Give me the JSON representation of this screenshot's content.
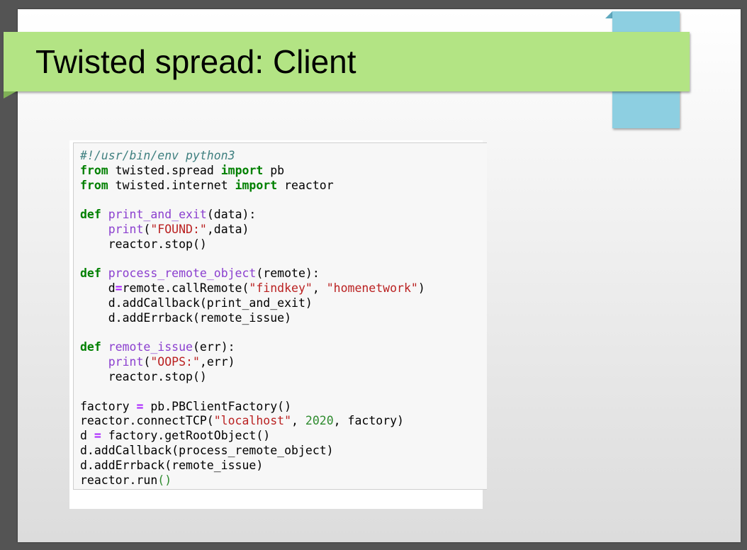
{
  "slide": {
    "title": "Twisted spread: Client"
  },
  "colors": {
    "background": "#545454",
    "title_bar": "#b3e484",
    "accent_tab": "#8dcfe1",
    "code_background": "#f7f7f7",
    "comment": "#408080",
    "keyword": "#008000",
    "builtin": "#8b3fcf",
    "string": "#ba2121",
    "number": "#2e8b2e"
  },
  "code": {
    "language": "python",
    "lines": [
      [
        {
          "t": "#!/usr/bin/env python3",
          "k": "comment"
        }
      ],
      [
        {
          "t": "from",
          "k": "keyword"
        },
        {
          "t": " twisted.spread ",
          "k": "plain"
        },
        {
          "t": "import",
          "k": "keyword"
        },
        {
          "t": " pb",
          "k": "plain"
        }
      ],
      [
        {
          "t": "from",
          "k": "keyword"
        },
        {
          "t": " twisted.internet ",
          "k": "plain"
        },
        {
          "t": "import",
          "k": "keyword"
        },
        {
          "t": " reactor",
          "k": "plain"
        }
      ],
      [],
      [
        {
          "t": "def",
          "k": "keyword"
        },
        {
          "t": " ",
          "k": "plain"
        },
        {
          "t": "print_and_exit",
          "k": "funcname"
        },
        {
          "t": "(data):",
          "k": "plain"
        }
      ],
      [
        {
          "t": "    ",
          "k": "plain"
        },
        {
          "t": "print",
          "k": "builtin"
        },
        {
          "t": "(",
          "k": "plain"
        },
        {
          "t": "\"FOUND:\"",
          "k": "string"
        },
        {
          "t": ",data)",
          "k": "plain"
        }
      ],
      [
        {
          "t": "    reactor.stop()",
          "k": "plain"
        }
      ],
      [],
      [
        {
          "t": "def",
          "k": "keyword"
        },
        {
          "t": " ",
          "k": "plain"
        },
        {
          "t": "process_remote_object",
          "k": "funcname"
        },
        {
          "t": "(remote):",
          "k": "plain"
        }
      ],
      [
        {
          "t": "    d",
          "k": "plain"
        },
        {
          "t": "=",
          "k": "operator"
        },
        {
          "t": "remote.callRemote(",
          "k": "plain"
        },
        {
          "t": "\"findkey\"",
          "k": "string"
        },
        {
          "t": ", ",
          "k": "plain"
        },
        {
          "t": "\"homenetwork\"",
          "k": "string"
        },
        {
          "t": ")",
          "k": "plain"
        }
      ],
      [
        {
          "t": "    d.addCallback(print_and_exit)",
          "k": "plain"
        }
      ],
      [
        {
          "t": "    d.addErrback(remote_issue)",
          "k": "plain"
        }
      ],
      [],
      [
        {
          "t": "def",
          "k": "keyword"
        },
        {
          "t": " ",
          "k": "plain"
        },
        {
          "t": "remote_issue",
          "k": "funcname"
        },
        {
          "t": "(err):",
          "k": "plain"
        }
      ],
      [
        {
          "t": "    ",
          "k": "plain"
        },
        {
          "t": "print",
          "k": "builtin"
        },
        {
          "t": "(",
          "k": "plain"
        },
        {
          "t": "\"OOPS:\"",
          "k": "string"
        },
        {
          "t": ",err)",
          "k": "plain"
        }
      ],
      [
        {
          "t": "    reactor.stop()",
          "k": "plain"
        }
      ],
      [],
      [
        {
          "t": "factory ",
          "k": "plain"
        },
        {
          "t": "=",
          "k": "operator"
        },
        {
          "t": " pb.PBClientFactory()",
          "k": "plain"
        }
      ],
      [
        {
          "t": "reactor.connectTCP(",
          "k": "plain"
        },
        {
          "t": "\"localhost\"",
          "k": "string"
        },
        {
          "t": ", ",
          "k": "plain"
        },
        {
          "t": "2020",
          "k": "number"
        },
        {
          "t": ", factory)",
          "k": "plain"
        }
      ],
      [
        {
          "t": "d ",
          "k": "plain"
        },
        {
          "t": "=",
          "k": "operator"
        },
        {
          "t": " factory.getRootObject()",
          "k": "plain"
        }
      ],
      [
        {
          "t": "d.addCallback(process_remote_object)",
          "k": "plain"
        }
      ],
      [
        {
          "t": "d.addErrback(remote_issue)",
          "k": "plain"
        }
      ],
      [
        {
          "t": "reactor.run",
          "k": "plain"
        },
        {
          "t": "()",
          "k": "paren-hl"
        }
      ]
    ]
  }
}
